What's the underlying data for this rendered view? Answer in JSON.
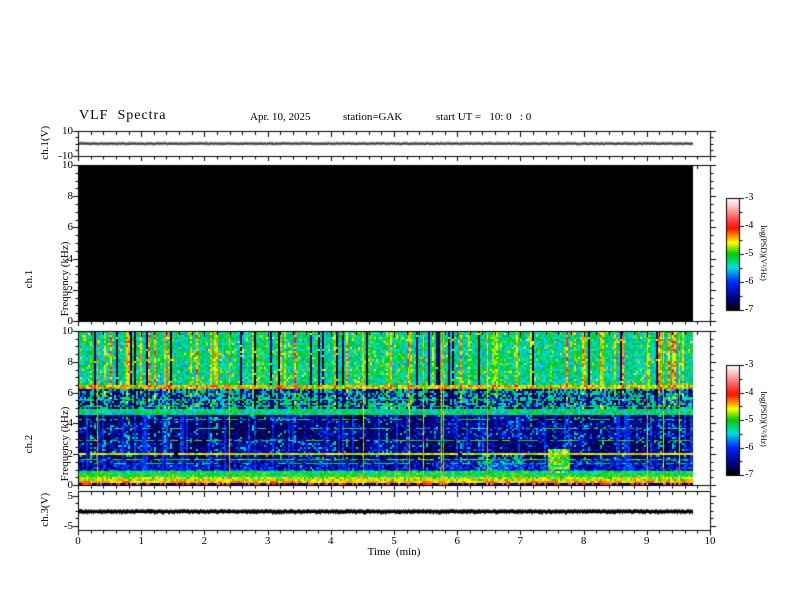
{
  "header": {
    "title": "VLF  Spectra",
    "date": "Apr. 10, 2025",
    "station": "station=GAK",
    "start_ut": "start UT =   10: 0   : 0"
  },
  "x_axis": {
    "label": "Time  (min)",
    "tick_labels": [
      "0",
      "1",
      "2",
      "3",
      "4",
      "5",
      "6",
      "7",
      "8",
      "9",
      "10"
    ],
    "tick_values": [
      0,
      1,
      2,
      3,
      4,
      5,
      6,
      7,
      8,
      9,
      10
    ],
    "minor_step": 0.2,
    "range": [
      0,
      10
    ]
  },
  "panels": {
    "ch1_wave": {
      "ylabel": "ch.1(V)",
      "ytick_labels": [
        "10",
        "-10"
      ],
      "ytick_values": [
        10,
        -10
      ],
      "y_minor_values": [
        5,
        0,
        -5
      ],
      "yrange": [
        10,
        -10
      ]
    },
    "ch1_spec": {
      "ylabel_lines": [
        "ch.1",
        "Frequency (kHz)"
      ],
      "ytick_labels": [
        "0",
        "2",
        "4",
        "6",
        "8",
        "10"
      ],
      "ytick_values": [
        0,
        2,
        4,
        6,
        8,
        10
      ],
      "y_minor_step_khz": 0.5,
      "yrange_khz": [
        0,
        10
      ]
    },
    "ch2_spec": {
      "ylabel_lines": [
        "ch.2",
        "Frequency (kHz)"
      ],
      "ytick_labels": [
        "0",
        "2",
        "4",
        "6",
        "8",
        "10"
      ],
      "ytick_values": [
        0,
        2,
        4,
        6,
        8,
        10
      ],
      "y_minor_step_khz": 0.5,
      "yrange_khz": [
        0,
        10
      ]
    },
    "ch3_wave": {
      "ylabel": "ch.3(V)",
      "ytick_labels": [
        "5",
        "-5"
      ],
      "ytick_values": [
        5,
        -5
      ],
      "y_minor_values": [
        2.5,
        0,
        -2.5
      ],
      "yrange": [
        6.5,
        -6.5
      ]
    }
  },
  "colorbar": {
    "label": "log(PSD)(V²/Hz)",
    "tick_labels": [
      "-3",
      "-4",
      "-5",
      "-6",
      "-7"
    ],
    "tick_values": [
      -3,
      -4,
      -5,
      -6,
      -7
    ],
    "range": [
      -7,
      -3
    ],
    "gradient_stops": [
      {
        "u": 0.0,
        "color": "#000000"
      },
      {
        "u": 0.1,
        "color": "#000080"
      },
      {
        "u": 0.25,
        "color": "#0028ff"
      },
      {
        "u": 0.38,
        "color": "#00e0e0"
      },
      {
        "u": 0.5,
        "color": "#00cc00"
      },
      {
        "u": 0.6,
        "color": "#ffff00"
      },
      {
        "u": 0.66,
        "color": "#ff9000"
      },
      {
        "u": 0.73,
        "color": "#ff1000"
      },
      {
        "u": 0.8,
        "color": "#ff4545"
      },
      {
        "u": 0.93,
        "color": "#ffc8c8"
      },
      {
        "u": 1.0,
        "color": "#ffffff"
      }
    ]
  },
  "chart_data": {
    "type": "heatmap",
    "title": "VLF Spectra",
    "date": "Apr. 10, 2025",
    "station": "GAK",
    "start_ut": "10:0:0",
    "x": {
      "label": "Time (min)",
      "range": [
        0,
        10
      ],
      "ticks": [
        0,
        1,
        2,
        3,
        4,
        5,
        6,
        7,
        8,
        9,
        10
      ],
      "data_extent_min": [
        0,
        9.73
      ]
    },
    "colorscale": {
      "label": "log(PSD)(V²/Hz)",
      "range": [
        -7,
        -3
      ],
      "order_top_to_bottom": [
        "white",
        "pink",
        "red",
        "orange",
        "yellow",
        "green",
        "cyan",
        "blue",
        "navy",
        "black"
      ]
    },
    "panels": [
      {
        "name": "ch.1(V)",
        "type": "line",
        "yticks": [
          10,
          -10
        ],
        "description": "flat waveform at ~0 V across full record (0 to ~9.73 min)"
      },
      {
        "name": "ch.1 Frequency (kHz)",
        "type": "heatmap",
        "yrange_khz": [
          0,
          10
        ],
        "description": "uniform PSD at/below -7 over 0-10 kHz: rendered solid black"
      },
      {
        "name": "ch.2 Frequency (kHz)",
        "type": "heatmap",
        "yrange_khz": [
          0,
          10
        ],
        "bands": [
          {
            "freq_khz": [
              6.6,
              10
            ],
            "psd_log": "-5.8 to -4.6",
            "description": "dense cyan/green vertical striping with blue columns and narrow black gaps"
          },
          {
            "freq_khz": [
              6.2,
              6.6
            ],
            "psd_log": "~ -4.6",
            "description": "bright continuous green/yellow horizontal band"
          },
          {
            "freq_khz": [
              5.0,
              6.2
            ],
            "psd_log": "-7 to -5.2",
            "description": "cyan speckle over black, thin horizontal cyan lines near 5.6 and 5.15 kHz"
          },
          {
            "freq_khz": [
              4.6,
              5.0
            ],
            "psd_log": "~ -5.4",
            "description": "brighter cyan speckle band"
          },
          {
            "freq_khz": [
              0.9,
              4.6
            ],
            "psd_log": "-7 to -6",
            "description": "mostly black/dark blue; dashed horizontal lines near 4.3, 3.7, 2.9, 2.05, 1.7, 1.45, 1.0 kHz; sparse blue vertical streaks"
          },
          {
            "freq_khz": [
              0.55,
              0.9
            ],
            "psd_log": "~ -5.2",
            "description": "cyan/green band"
          },
          {
            "freq_khz": [
              0.2,
              0.55
            ],
            "psd_log": "~ -4.7",
            "description": "bright solid green/yellow band"
          },
          {
            "freq_khz": [
              0.0,
              0.2
            ],
            "psd_log": "-4 speckles on -7",
            "description": "red/orange speckle at bottom edge"
          }
        ],
        "features": [
          "narrow full-height yellow-green vertical lines at random times",
          "bright green patch near 7.5-7.7 min below 2.3 kHz",
          "fainter green patches 6.3-7.0 min below 1.9 kHz"
        ]
      },
      {
        "name": "ch.3(V)",
        "type": "line",
        "yticks": [
          5,
          -5
        ],
        "description": "flat thick noisy trace at ~0 V across full record"
      }
    ]
  }
}
